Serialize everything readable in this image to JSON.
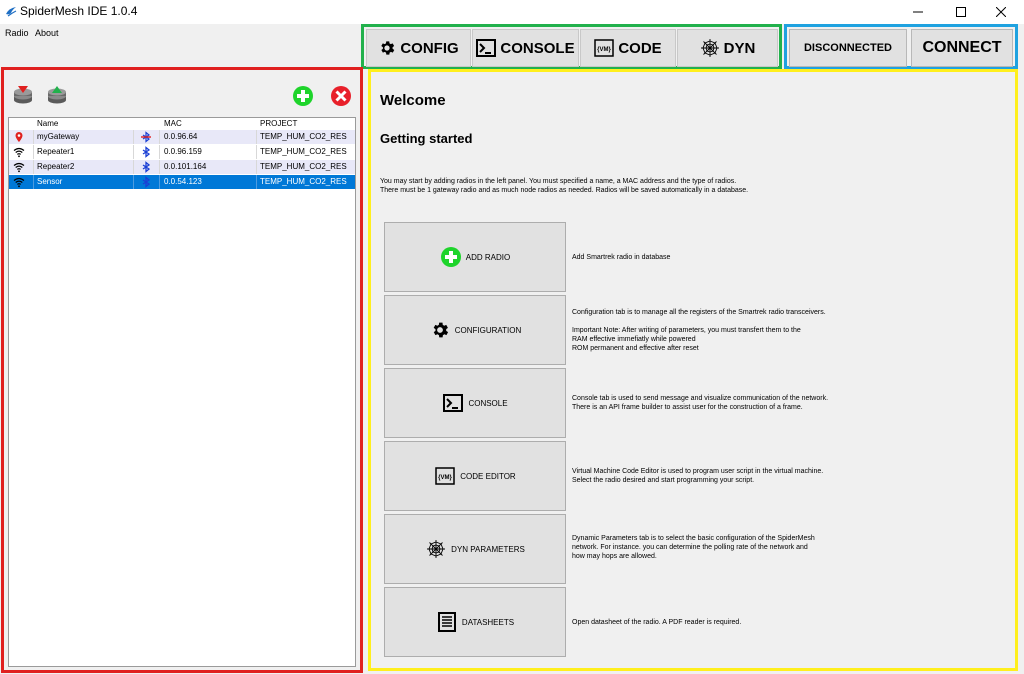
{
  "window": {
    "title": "SpiderMesh IDE 1.0.4"
  },
  "menu": {
    "items": [
      "Radio",
      "About"
    ]
  },
  "tabs": [
    {
      "label": "CONFIG",
      "icon": "gear-icon"
    },
    {
      "label": "CONSOLE",
      "icon": "terminal-icon"
    },
    {
      "label": "CODE",
      "icon": "vm-icon"
    },
    {
      "label": "DYN",
      "icon": "spider-web-icon"
    }
  ],
  "connection": {
    "status": "DISCONNECTED",
    "connect_label": "CONNECT"
  },
  "radio_list": {
    "columns": [
      "Name",
      "MAC",
      "PROJECT"
    ],
    "rows": [
      {
        "name": "myGateway",
        "mac": "0.0.96.64",
        "project": "TEMP_HUM_CO2_RES",
        "type_icon": "location-pin-icon",
        "status_icon": "bluetooth-crossed-icon"
      },
      {
        "name": "Repeater1",
        "mac": "0.0.96.159",
        "project": "TEMP_HUM_CO2_RES",
        "type_icon": "wifi-icon",
        "status_icon": "bluetooth-icon"
      },
      {
        "name": "Repeater2",
        "mac": "0.0.101.164",
        "project": "TEMP_HUM_CO2_RES",
        "type_icon": "wifi-icon",
        "status_icon": "bluetooth-icon"
      },
      {
        "name": "Sensor",
        "mac": "0.0.54.123",
        "project": "TEMP_HUM_CO2_RES",
        "type_icon": "wifi-icon",
        "status_icon": "bluetooth-icon",
        "selected": true
      }
    ]
  },
  "welcome": {
    "title": "Welcome",
    "subtitle": "Getting started",
    "intro": [
      "You may start by adding radios in the left panel. You must specified a name, a MAC address and the type of radios.",
      "There must be 1 gateway radio and as much node radios as needed. Radios will be saved automatically in a database."
    ],
    "features": [
      {
        "label": "ADD RADIO",
        "icon": "add-circle-icon",
        "desc": [
          "Add Smartrek radio in database"
        ]
      },
      {
        "label": "CONFIGURATION",
        "icon": "gear-icon",
        "desc": [
          "Configuration tab is to manage all the registers of the Smartrek radio transceivers.",
          "",
          "Important Note: After writing of parameters, you must transfert them to the",
          "RAM effective immefiatly while powered",
          "ROM permanent and effective after reset"
        ]
      },
      {
        "label": "CONSOLE",
        "icon": "terminal-icon",
        "desc": [
          "Console tab is used to send message and visualize communication of the network.",
          "There is an API frame builder to assist user for the construction of a frame."
        ]
      },
      {
        "label": "CODE EDITOR",
        "icon": "vm-icon",
        "desc": [
          "Virtual Machine Code Editor is used to program user script in the virtual machine.",
          "Select the radio desired and start programming your script."
        ]
      },
      {
        "label": "DYN PARAMETERS",
        "icon": "spider-web-icon",
        "desc": [
          "Dynamic Parameters tab is to select the basic configuration of the SpiderMesh",
          "network. For instance. you can determine the polling rate of the network and",
          "how may hops are allowed."
        ]
      },
      {
        "label": "DATASHEETS",
        "icon": "document-icon",
        "desc": [
          "Open datasheet of the radio. A PDF reader is required."
        ]
      }
    ]
  },
  "colors": {
    "tab_border": "#22b14c",
    "connection_border": "#1fa2e0",
    "left_panel_border": "#e0201f",
    "right_panel_border": "#ffef1d",
    "selection": "#0078d7"
  }
}
